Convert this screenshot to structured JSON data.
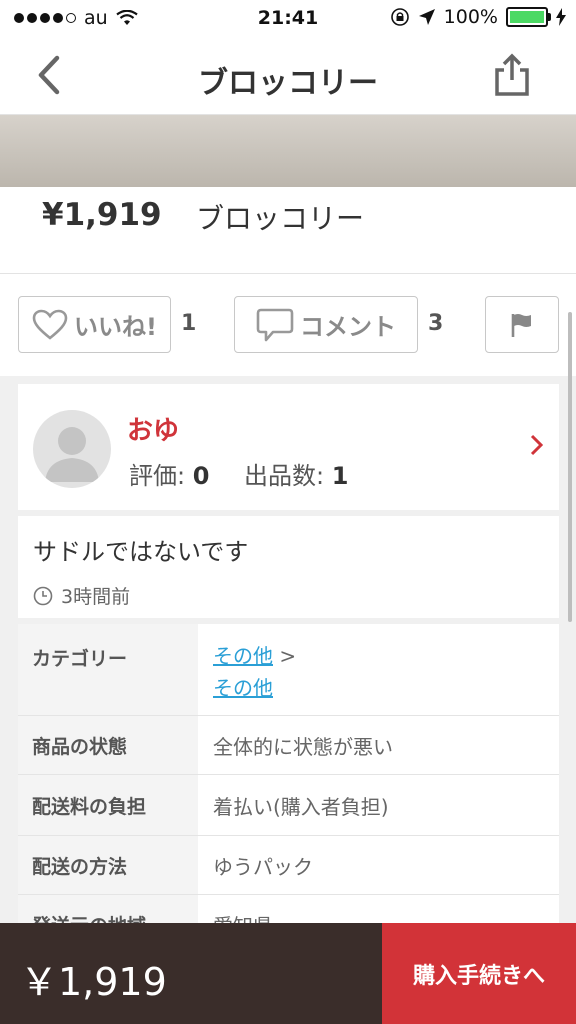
{
  "status": {
    "carrier": "au",
    "time": "21:41",
    "battery": "100%"
  },
  "nav": {
    "title": "ブロッコリー"
  },
  "product": {
    "price": "¥1,919",
    "title": "ブロッコリー"
  },
  "actions": {
    "like_label": "いいね!",
    "like_count": "1",
    "comment_label": "コメント",
    "comment_count": "3"
  },
  "seller": {
    "name": "おゆ",
    "rating_label": "評価:",
    "rating_value": "0",
    "listings_label": "出品数:",
    "listings_value": "1"
  },
  "description": {
    "text": "サドルではないです",
    "time": "3時間前"
  },
  "details": {
    "category_label": "カテゴリー",
    "category_1": "その他",
    "category_sep": ">",
    "category_2": "その他",
    "condition_label": "商品の状態",
    "condition_value": "全体的に状態が悪い",
    "shipping_fee_label": "配送料の負担",
    "shipping_fee_value": "着払い(購入者負担)",
    "shipping_method_label": "配送の方法",
    "shipping_method_value": "ゆうパック",
    "origin_label": "発送元の地域",
    "origin_value": "愛知県"
  },
  "bottom": {
    "price": "￥1,919",
    "buy_label": "購入手続きへ"
  },
  "colors": {
    "accent_red": "#d23338",
    "seller_name": "#d0343a",
    "bottom_dark": "#3a2d2a",
    "link": "#2a9fd6"
  }
}
